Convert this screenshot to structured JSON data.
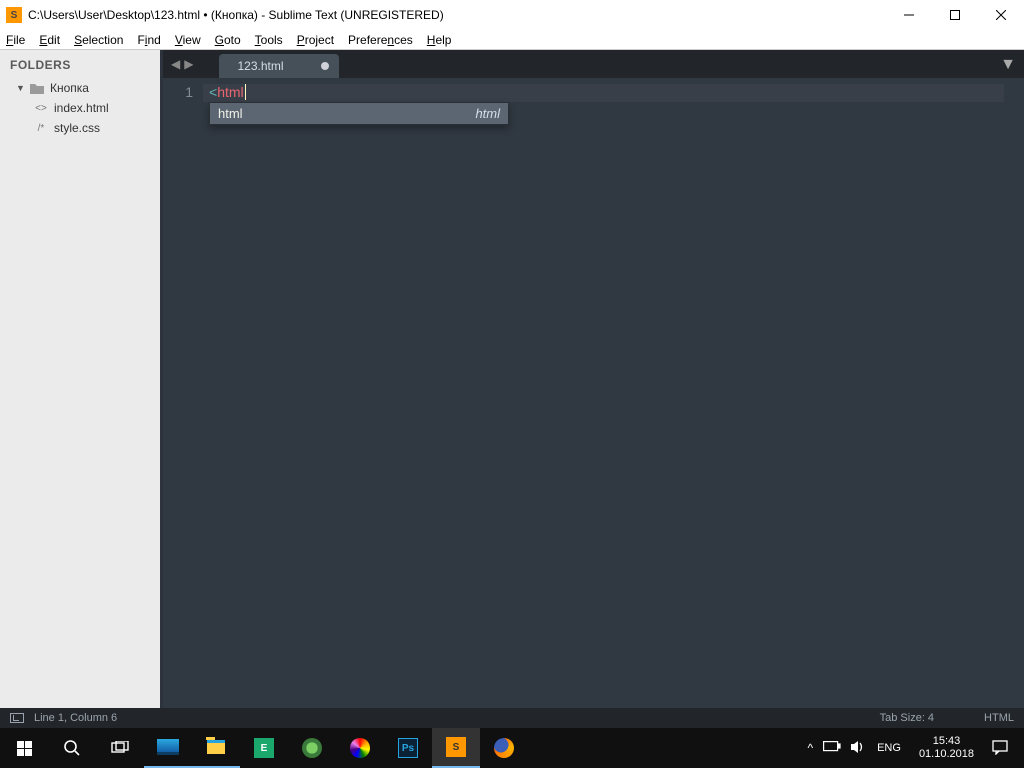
{
  "window": {
    "title": "C:\\Users\\User\\Desktop\\123.html • (Кнопка) - Sublime Text (UNREGISTERED)"
  },
  "menu": {
    "file": "File",
    "edit": "Edit",
    "selection": "Selection",
    "find": "Find",
    "view": "View",
    "goto": "Goto",
    "tools": "Tools",
    "project": "Project",
    "preferences": "Preferences",
    "help": "Help"
  },
  "sidebar": {
    "heading": "FOLDERS",
    "root": "Кнопка",
    "files": [
      {
        "icon": "<>",
        "name": "index.html"
      },
      {
        "icon": "/*",
        "name": "style.css"
      }
    ]
  },
  "tab": {
    "name": "123.html"
  },
  "code": {
    "line_no": "1",
    "bracket": "<",
    "tag": "html"
  },
  "autocomplete": {
    "match": "html",
    "kind": "html"
  },
  "status": {
    "pos": "Line 1, Column 6",
    "tabsize": "Tab Size: 4",
    "syntax": "HTML"
  },
  "tray": {
    "lang": "ENG",
    "time": "15:43",
    "date": "01.10.2018"
  }
}
